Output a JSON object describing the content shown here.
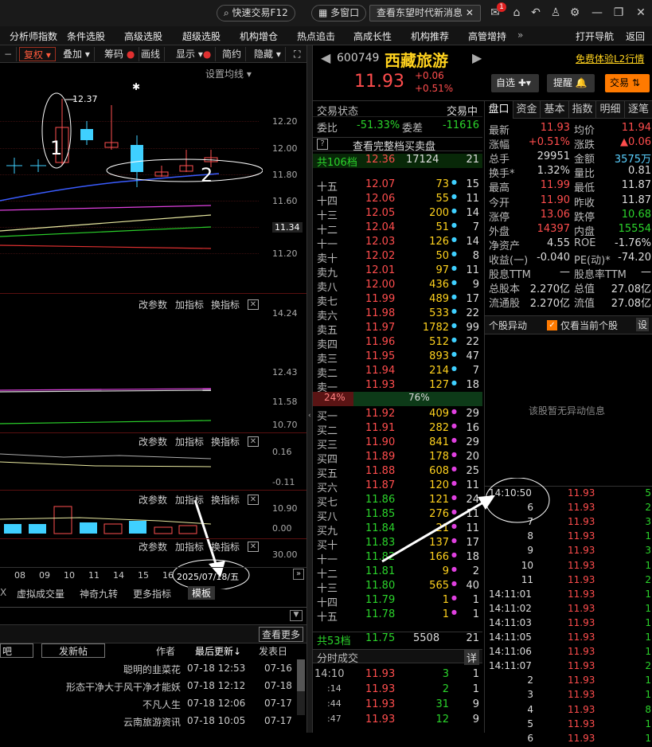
{
  "titlebar": {
    "quick_trade": "快速交易F12",
    "multi_window": "多窗口",
    "news": "查看东望时代新消息",
    "badge": "1"
  },
  "menu": [
    "分析师指数",
    "条件选股",
    "高级选股",
    "超级选股",
    "机构增仓",
    "热点追击",
    "高成长性",
    "机构推荐",
    "高管增持"
  ],
  "menu_right": [
    "打开导航",
    "返回"
  ],
  "chart_toolbar": [
    "复权",
    "叠加",
    "筹码",
    "画线",
    "显示",
    "简约",
    "隐藏"
  ],
  "chart": {
    "avg_setting": "设置均线",
    "hi_label": "12.37",
    "star": "✱",
    "axis_main": [
      "12.20",
      "12.00",
      "11.80",
      "11.60",
      "11.40",
      "11.20"
    ],
    "price_tag": "11.34",
    "axis_p1": [
      "14.24",
      "12.43",
      "11.58",
      "10.70"
    ],
    "axis_p2": [
      "0.16",
      "-0.11"
    ],
    "axis_p3": [
      "10.90",
      "0.00"
    ],
    "axis_p4": [
      "30.00"
    ],
    "pane_btns": [
      "改参数",
      "加指标",
      "换指标"
    ],
    "dates": [
      "08",
      "09",
      "10",
      "11",
      "14",
      "15",
      "16"
    ],
    "date_box": "2025/07/18/五",
    "annot1": "1",
    "annot2": "2"
  },
  "bottom": {
    "tabs": [
      "虚拟成交量",
      "神奇九转",
      "更多指标",
      "模板"
    ],
    "lookmore": "查看更多",
    "bar": "吧",
    "post": "发新帖",
    "cols": [
      "作者",
      "最后更新↓",
      "发表日"
    ],
    "posts": [
      {
        "a": "聪明的韭菜花",
        "u": "07-18 12:53",
        "p": "07-16"
      },
      {
        "a": "形态干净大于风干净才能妖",
        "u": "07-18 12:12",
        "p": "07-18"
      },
      {
        "a": "不凡人生",
        "u": "07-18 12:06",
        "p": "07-17"
      },
      {
        "a": "云南旅游资讯",
        "u": "07-18 10:05",
        "p": "07-17"
      }
    ]
  },
  "stock": {
    "code": "600749",
    "name": "西藏旅游",
    "price": "11.93",
    "chg": "+0.06",
    "pct": "+0.51%",
    "l2": "免费体验L2行情",
    "watch": "自选",
    "alert": "提醒",
    "trade": "交易"
  },
  "book": {
    "status_l": "交易状态",
    "status_r": "交易中",
    "wb_l": "委比",
    "wb": "-51.33%",
    "wc_l": "委差",
    "wc": "-11616",
    "full": "查看完整档买卖盘",
    "top": {
      "l": "共106档",
      "p": "12.36",
      "v": "17124",
      "c": "21"
    },
    "asks": [
      [
        "十五",
        "12.07",
        "73",
        "15"
      ],
      [
        "十四",
        "12.06",
        "55",
        "11"
      ],
      [
        "十三",
        "12.05",
        "200",
        "14"
      ],
      [
        "十二",
        "12.04",
        "51",
        "7"
      ],
      [
        "十一",
        "12.03",
        "126",
        "14"
      ],
      [
        "卖十",
        "12.02",
        "50",
        "8"
      ],
      [
        "卖九",
        "12.01",
        "97",
        "11"
      ],
      [
        "卖八",
        "12.00",
        "436",
        "9"
      ],
      [
        "卖七",
        "11.99",
        "489",
        "17"
      ],
      [
        "卖六",
        "11.98",
        "533",
        "22"
      ],
      [
        "卖五",
        "11.97",
        "1782",
        "99"
      ],
      [
        "卖四",
        "11.96",
        "512",
        "22"
      ],
      [
        "卖三",
        "11.95",
        "893",
        "47"
      ],
      [
        "卖二",
        "11.94",
        "214",
        "7"
      ],
      [
        "卖一",
        "11.93",
        "127",
        "18"
      ]
    ],
    "ratio_l": "24%",
    "ratio_r": "76%",
    "bids": [
      [
        "买一",
        "11.92",
        "409",
        "29"
      ],
      [
        "买二",
        "11.91",
        "282",
        "16"
      ],
      [
        "买三",
        "11.90",
        "841",
        "29"
      ],
      [
        "买四",
        "11.89",
        "178",
        "20"
      ],
      [
        "买五",
        "11.88",
        "608",
        "25"
      ],
      [
        "买六",
        "11.87",
        "120",
        "11"
      ],
      [
        "买七",
        "11.86",
        "121",
        "24"
      ],
      [
        "买八",
        "11.85",
        "276",
        "11"
      ],
      [
        "买九",
        "11.84",
        "21",
        "11"
      ],
      [
        "买十",
        "11.83",
        "137",
        "17"
      ],
      [
        "十一",
        "11.82",
        "166",
        "18"
      ],
      [
        "十二",
        "11.81",
        "9",
        "2"
      ],
      [
        "十三",
        "11.80",
        "565",
        "40"
      ],
      [
        "十四",
        "11.79",
        "1",
        "1"
      ],
      [
        "十五",
        "11.78",
        "1",
        "1"
      ]
    ],
    "bottom_l": {
      "l": "共53档",
      "p": "11.75",
      "v": "5508",
      "c": "21"
    },
    "ticks_title": "分时成交",
    "ticks_detail": "详",
    "ticks": [
      [
        "14:10",
        "11.93",
        "3",
        "1"
      ],
      [
        ":14",
        "11.93",
        "2",
        "1"
      ],
      [
        ":44",
        "11.93",
        "31",
        "9"
      ],
      [
        ":47",
        "11.93",
        "12",
        "9"
      ]
    ]
  },
  "quote": {
    "tabs": [
      "盘口",
      "资金",
      "基本",
      "指数",
      "明细",
      "逐笔"
    ],
    "rows": [
      [
        "最新",
        "11.93",
        "均价",
        "11.94"
      ],
      [
        "涨幅",
        "+0.51%",
        "涨跌",
        "▲0.06"
      ],
      [
        "总手",
        "29951",
        "金额",
        "3575万"
      ],
      [
        "换手*",
        "1.32%",
        "量比",
        "0.81"
      ],
      [
        "最高",
        "11.99",
        "最低",
        "11.87"
      ],
      [
        "今开",
        "11.90",
        "昨收",
        "11.87"
      ],
      [
        "涨停",
        "13.06",
        "跌停",
        "10.68"
      ],
      [
        "外盘",
        "14397",
        "内盘",
        "15554"
      ],
      [
        "净资产",
        "4.55",
        "ROE",
        "-1.76%"
      ],
      [
        "收益(一)",
        "-0.040",
        "PE(动)*",
        "-74.20"
      ],
      [
        "股息TTM",
        "—",
        "股息率TTM",
        "—"
      ],
      [
        "总股本",
        "2.270亿",
        "总值",
        "27.08亿"
      ],
      [
        "流通股",
        "2.270亿",
        "流值",
        "27.08亿"
      ]
    ],
    "anomaly": "个股异动",
    "only_current": "仅看当前个股",
    "set": "设",
    "empty": "该股暂无异动信息",
    "trades": [
      [
        "14:10:50",
        "11.93",
        "5"
      ],
      [
        "6",
        "11.93",
        "2"
      ],
      [
        "7",
        "11.93",
        "3"
      ],
      [
        "8",
        "11.93",
        "1"
      ],
      [
        "9",
        "11.93",
        "3"
      ],
      [
        "10",
        "11.93",
        "1"
      ],
      [
        "11",
        "11.93",
        "2"
      ],
      [
        "14:11:01",
        "11.93",
        "1"
      ],
      [
        "14:11:02",
        "11.93",
        "1"
      ],
      [
        "14:11:03",
        "11.93",
        "1"
      ],
      [
        "14:11:05",
        "11.93",
        "1"
      ],
      [
        "14:11:06",
        "11.93",
        "1"
      ],
      [
        "14:11:07",
        "11.93",
        "2"
      ],
      [
        "2",
        "11.93",
        "1"
      ],
      [
        "3",
        "11.93",
        "1"
      ],
      [
        "4",
        "11.93",
        "8"
      ],
      [
        "5",
        "11.93",
        "1"
      ],
      [
        "6",
        "11.93",
        "1"
      ]
    ]
  }
}
